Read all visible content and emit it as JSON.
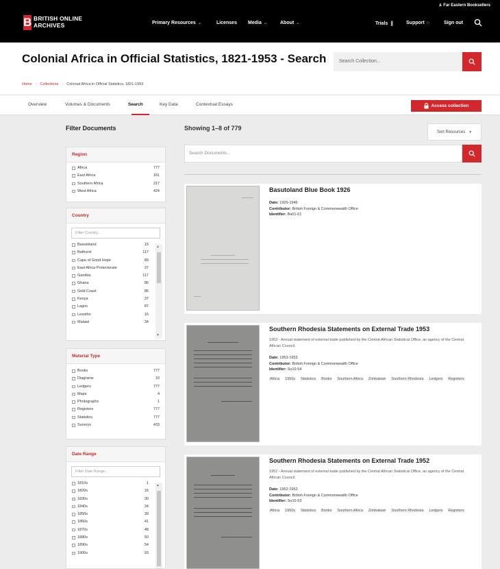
{
  "brand": {
    "line1": "BRITISH ONLINE",
    "line2": "ARCHIVES"
  },
  "nav": {
    "primary_resources": "Primary Resources",
    "licenses": "Licenses",
    "media": "Media",
    "about": "About",
    "trials": "Trials",
    "support": "Support",
    "sign_out": "Sign out",
    "far_eastern": "Far Eastern Booksellers"
  },
  "page": {
    "title": "Colonial Africa in Official Statistics, 1821-1953 - Search"
  },
  "collection_search": {
    "placeholder": "Search Collection..."
  },
  "breadcrumb": {
    "home": "Home",
    "collections": "Collections",
    "current": "Colonial Africa in Official Statistics, 1821-1953"
  },
  "tabs": [
    "Overview",
    "Volumes & Documents",
    "Search",
    "Key Data",
    "Contextual Essays"
  ],
  "access_button": "Access collection",
  "sidebar": {
    "title": "Filter Documents",
    "region": {
      "heading": "Region",
      "items": [
        {
          "label": "Africa",
          "count": "777"
        },
        {
          "label": "East Africa",
          "count": "161"
        },
        {
          "label": "Southern Africa",
          "count": "217"
        },
        {
          "label": "West Africa",
          "count": "424"
        }
      ]
    },
    "country": {
      "heading": "Country",
      "placeholder": "Filter Country...",
      "items": [
        {
          "label": "Basutoland",
          "count": "15"
        },
        {
          "label": "Bathurst",
          "count": "117"
        },
        {
          "label": "Cape of Good Hope",
          "count": "89"
        },
        {
          "label": "East Africa Protectorate",
          "count": "37"
        },
        {
          "label": "Gambia",
          "count": "117"
        },
        {
          "label": "Ghana",
          "count": "86"
        },
        {
          "label": "Gold Coast",
          "count": "86"
        },
        {
          "label": "Kenya",
          "count": "37"
        },
        {
          "label": "Lagos",
          "count": "87"
        },
        {
          "label": "Lesotho",
          "count": "15"
        },
        {
          "label": "Malawi",
          "count": "34"
        }
      ]
    },
    "material": {
      "heading": "Material Type",
      "items": [
        {
          "label": "Books",
          "count": "777"
        },
        {
          "label": "Diagrams",
          "count": "10"
        },
        {
          "label": "Ledgers",
          "count": "777"
        },
        {
          "label": "Maps",
          "count": "4"
        },
        {
          "label": "Photographs",
          "count": "1"
        },
        {
          "label": "Registers",
          "count": "777"
        },
        {
          "label": "Statistics",
          "count": "777"
        },
        {
          "label": "Surveys",
          "count": "433"
        }
      ]
    },
    "date_range": {
      "heading": "Date Range",
      "placeholder": "Filter Date Range...",
      "items": [
        {
          "label": "1810s",
          "count": "1"
        },
        {
          "label": "1820s",
          "count": "16"
        },
        {
          "label": "1830s",
          "count": "30"
        },
        {
          "label": "1840s",
          "count": "34"
        },
        {
          "label": "1850s",
          "count": "39"
        },
        {
          "label": "1860s",
          "count": "41"
        },
        {
          "label": "1870s",
          "count": "48"
        },
        {
          "label": "1880s",
          "count": "50"
        },
        {
          "label": "1890s",
          "count": "54"
        },
        {
          "label": "1900s",
          "count": "93"
        }
      ]
    }
  },
  "results": {
    "showing": "Showing 1–8 of 779",
    "sort_label": "Sort Resources",
    "doc_search_placeholder": "Search Documents...",
    "labels": {
      "date": "Date:",
      "contributor": "Contributor:",
      "identifier": "Identifier:"
    },
    "items": [
      {
        "title": "Basutoland Blue Book 1926",
        "date": "1926-1946",
        "contributor": "British Foreign & Commonwealth Office",
        "identifier": "Ba01-01"
      },
      {
        "title": "Southern Rhodesia Statements on External Trade 1953",
        "desc": "1953 - Annual statement of external trade published by the Central African Statistical Office, an agency of the Central African Council.",
        "date": "1953-1953",
        "contributor": "British Foreign & Commonwealth Office",
        "identifier": "So10-54",
        "tags": [
          "Africa",
          "1950s",
          "Statistics",
          "Books",
          "Southern Africa",
          "Zimbabwe",
          "Southern Rhodesia",
          "Ledgers",
          "Registers"
        ]
      },
      {
        "title": "Southern Rhodesia Statements on External Trade 1952",
        "desc": "1952 - Annual statement of external trade published by the Central African Statistical Office, an agency of the Central African Council.",
        "date": "1952-1952",
        "contributor": "British Foreign & Commonwealth Office",
        "identifier": "So10-53",
        "tags": [
          "Africa",
          "1950s",
          "Statistics",
          "Books",
          "Southern Africa",
          "Zimbabwe",
          "Southern Rhodesia",
          "Ledgers",
          "Registers"
        ]
      }
    ]
  },
  "colors": {
    "accent": "#d1282e",
    "topbar": "#000000",
    "sidebar_bg": "#ececec"
  },
  "icons": [
    "search-icon",
    "chevron-down-icon",
    "lock-icon",
    "user-icon",
    "sort-caret-icon"
  ]
}
